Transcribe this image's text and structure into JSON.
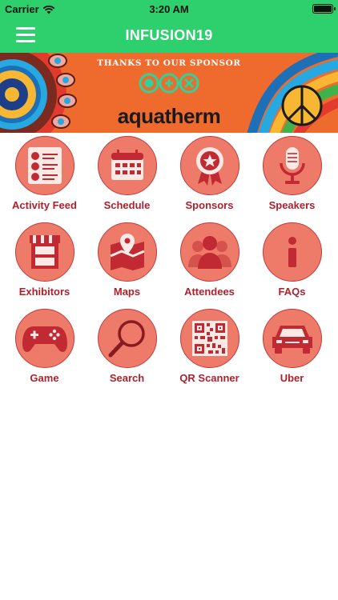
{
  "status_bar": {
    "carrier": "Carrier",
    "time": "3:20 AM"
  },
  "nav": {
    "title": "INFUSION19"
  },
  "banner": {
    "thanks_text": "THANKS TO OUR SPONSOR",
    "brand": "aquatherm"
  },
  "colors": {
    "header": "#2ed06e",
    "tile_fill": "#ee7b6a",
    "tile_border": "#c23a3a",
    "icon": "#c22a33",
    "label": "#b01f2a",
    "banner": "#ef6a2d"
  },
  "tiles": [
    {
      "label": "Activity Feed",
      "icon": "activity-feed-icon"
    },
    {
      "label": "Schedule",
      "icon": "calendar-icon"
    },
    {
      "label": "Sponsors",
      "icon": "award-ribbon-icon"
    },
    {
      "label": "Speakers",
      "icon": "microphone-icon"
    },
    {
      "label": "Exhibitors",
      "icon": "booth-icon"
    },
    {
      "label": "Maps",
      "icon": "map-pin-icon"
    },
    {
      "label": "Attendees",
      "icon": "people-icon"
    },
    {
      "label": "FAQs",
      "icon": "info-icon"
    },
    {
      "label": "Game",
      "icon": "gamepad-icon"
    },
    {
      "label": "Search",
      "icon": "magnifier-icon"
    },
    {
      "label": "QR Scanner",
      "icon": "qr-code-icon"
    },
    {
      "label": "Uber",
      "icon": "car-icon"
    }
  ]
}
